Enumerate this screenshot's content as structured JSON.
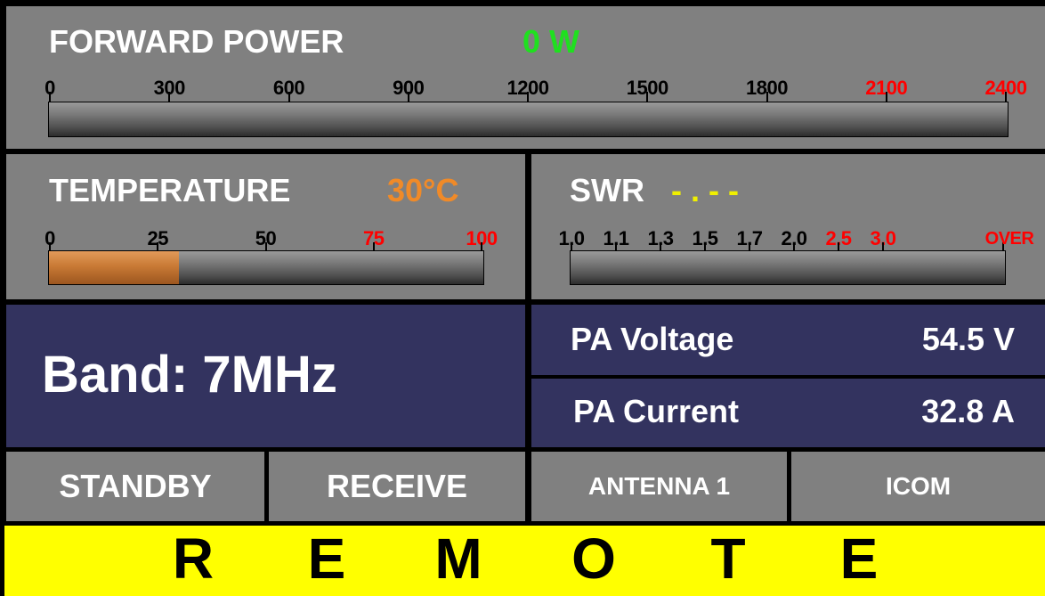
{
  "forward_power": {
    "title": "FORWARD POWER",
    "value": "0 W",
    "value_color": "#1fe01f",
    "level": 0,
    "ticks": [
      {
        "label": "0",
        "color": "#000000"
      },
      {
        "label": "300",
        "color": "#000000"
      },
      {
        "label": "600",
        "color": "#000000"
      },
      {
        "label": "900",
        "color": "#000000"
      },
      {
        "label": "1200",
        "color": "#000000"
      },
      {
        "label": "1500",
        "color": "#000000"
      },
      {
        "label": "1800",
        "color": "#000000"
      },
      {
        "label": "2100",
        "color": "#ff0000"
      },
      {
        "label": "2400",
        "color": "#ff0000"
      }
    ]
  },
  "temperature": {
    "title": "TEMPERATURE",
    "value": "30°C",
    "value_color": "#f08a28",
    "level": 0.3,
    "ticks": [
      {
        "label": "0",
        "color": "#000000"
      },
      {
        "label": "25",
        "color": "#000000"
      },
      {
        "label": "50",
        "color": "#000000"
      },
      {
        "label": "75",
        "color": "#ff0000"
      },
      {
        "label": "100",
        "color": "#ff0000"
      }
    ]
  },
  "swr": {
    "title": "SWR",
    "value": "- . - -",
    "value_color": "#f0f000",
    "level": 0,
    "ticks": [
      {
        "label": "1.0",
        "color": "#000000"
      },
      {
        "label": "1.1",
        "color": "#000000"
      },
      {
        "label": "1.3",
        "color": "#000000"
      },
      {
        "label": "1.5",
        "color": "#000000"
      },
      {
        "label": "1.7",
        "color": "#000000"
      },
      {
        "label": "2.0",
        "color": "#000000"
      },
      {
        "label": "2.5",
        "color": "#ff0000"
      },
      {
        "label": "3.0",
        "color": "#ff0000"
      }
    ],
    "over_label": "OVER"
  },
  "band": {
    "text": "Band: 7MHz"
  },
  "pa_voltage": {
    "label": "PA Voltage",
    "value": "54.5 V"
  },
  "pa_current": {
    "label": "PA Current",
    "value": "32.8 A"
  },
  "buttons": {
    "standby": "STANDBY",
    "receive": "RECEIVE",
    "antenna": "ANTENNA 1",
    "radio": "ICOM"
  },
  "remote": {
    "letters": [
      "R",
      "E",
      "M",
      "O",
      "T",
      "E"
    ]
  },
  "colors": {
    "panel": "#808080",
    "navy": "#33335f",
    "remote_bg": "#ffff00",
    "temp_fill": "#c97a35"
  }
}
